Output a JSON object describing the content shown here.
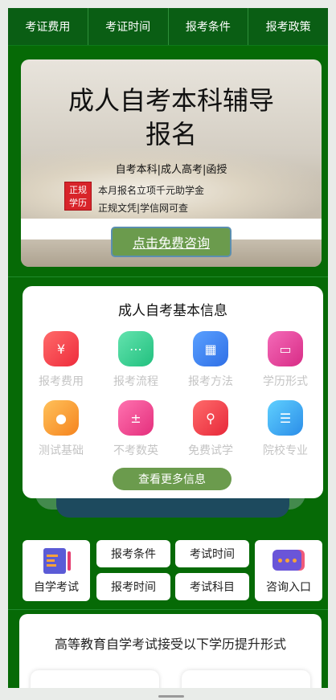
{
  "nav": {
    "tabs": [
      "考证费用",
      "考证时间",
      "报考条件",
      "报考政策"
    ]
  },
  "banner": {
    "title": "成人自考本科辅导报名",
    "subtitle": "自考本科|成人高考|函授",
    "seal_text": "正规学历",
    "point1": "本月报名立项千元助学金",
    "point2": "正规文凭|学信网可查",
    "cta_label": "点击免费咨询"
  },
  "info": {
    "heading": "成人自考基本信息",
    "items": [
      {
        "label": "报考费用",
        "icon": "ticket-icon",
        "color": "#f2404b"
      },
      {
        "label": "报考流程",
        "icon": "flow-icon",
        "color": "#2ecf8f"
      },
      {
        "label": "报考方法",
        "icon": "grid-icon",
        "color": "#3a7ef0"
      },
      {
        "label": "学历形式",
        "icon": "certificate-icon",
        "color": "#e0368f"
      },
      {
        "label": "测试基础",
        "icon": "medal-icon",
        "color": "#f59a27"
      },
      {
        "label": "不考数英",
        "icon": "calculator-icon",
        "color": "#ec3b87"
      },
      {
        "label": "免费试学",
        "icon": "search-icon",
        "color": "#f0323e"
      },
      {
        "label": "院校专业",
        "icon": "list-icon",
        "color": "#2f9ef0"
      }
    ],
    "more_label": "查看更多信息"
  },
  "quick": {
    "left_label": "自学考试",
    "left_icon": "notebook-icon",
    "buttons": [
      "报考条件",
      "考试时间",
      "报考时间",
      "考试科目"
    ],
    "right_label": "咨询入口",
    "right_icon": "chat-icon"
  },
  "bottom": {
    "heading": "高等教育自学考试接受以下学历提升形式"
  }
}
